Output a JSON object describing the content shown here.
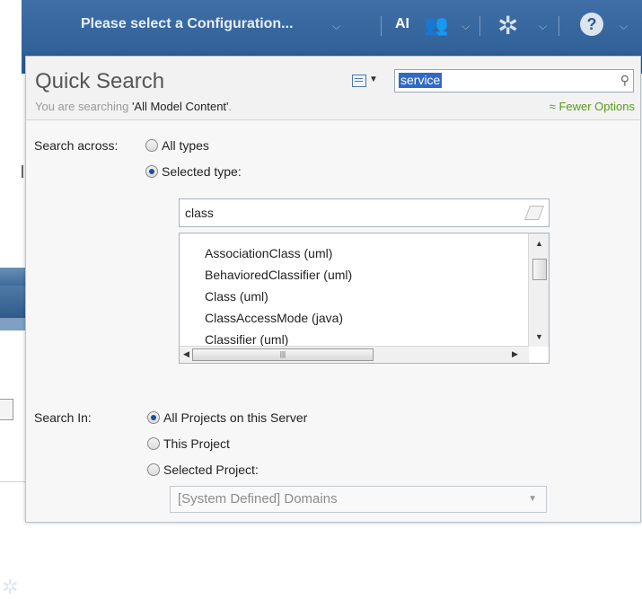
{
  "header": {
    "config_label": "Please select a Configuration...",
    "ai_label": "AI"
  },
  "quick_search": {
    "title": "Quick Search",
    "subtitle_prefix": "You are searching ",
    "subtitle_scope": "'All Model Content'",
    "subtitle_suffix": ".",
    "fewer_options": "Fewer Options",
    "search_value": "service"
  },
  "search_across": {
    "label": "Search across:",
    "option_all": "All types",
    "option_selected": "Selected type:",
    "selected_option": "Selected type:",
    "type_filter": "class",
    "types": [
      "AssociationClass (uml)",
      "BehavioredClassifier (uml)",
      "Class (uml)",
      "ClassAccessMode (java)",
      "Classifier (uml)"
    ]
  },
  "search_in": {
    "label": "Search In:",
    "option_all": "All Projects on this Server",
    "option_this": "This Project",
    "option_selected": "Selected Project:",
    "selected_option": "All Projects on this Server",
    "project_dropdown_value": "[System Defined] Domains"
  },
  "icons": {
    "people": "people-icon",
    "settings": "gear-icon",
    "help": "help-icon",
    "search": "search-icon",
    "eraser": "eraser-icon"
  },
  "colors": {
    "banner": "#2a5b92",
    "selection": "#316ac5",
    "fewer_options": "#5a9a1a"
  }
}
